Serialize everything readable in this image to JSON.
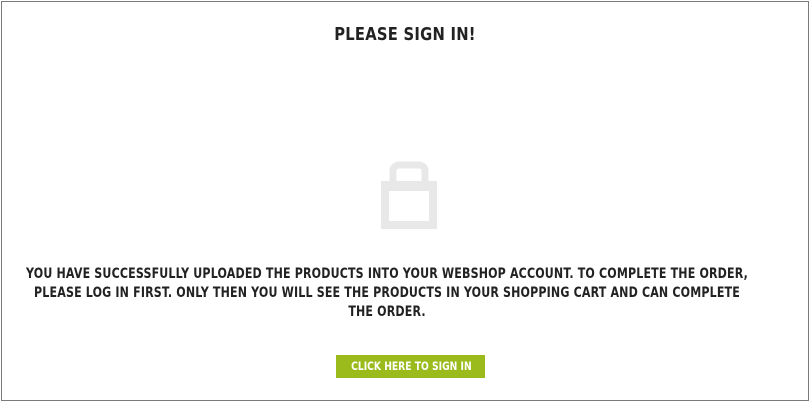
{
  "dialog": {
    "title": "PLEASE SIGN IN!",
    "icon": "shopping-bag-icon",
    "message": "YOU HAVE SUCCESSFULLY UPLOADED THE PRODUCTS INTO YOUR WEBSHOP ACCOUNT. TO COMPLETE THE ORDER, PLEASE LOG IN FIRST. ONLY THEN YOU WILL SEE THE PRODUCTS IN YOUR SHOPPING CART AND CAN COMPLETE THE ORDER.",
    "button_label": "CLICK HERE TO SIGN IN"
  },
  "colors": {
    "accent": "#9bbb1c",
    "icon": "#e8e8e8",
    "text": "#222222",
    "border": "#7a7a7a"
  }
}
